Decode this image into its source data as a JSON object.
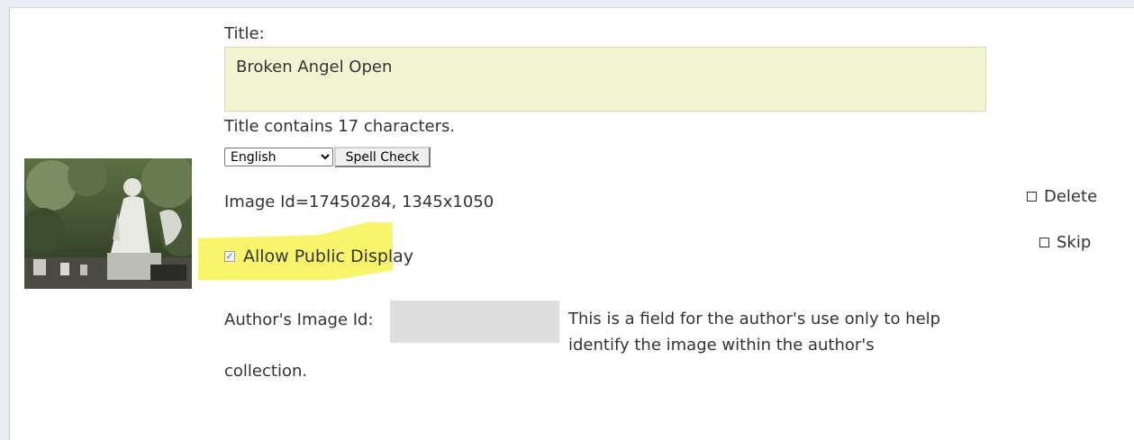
{
  "form": {
    "title_label": "Title:",
    "title_value": "Broken Angel Open",
    "title_count": "Title contains 17 characters.",
    "language": {
      "selected": "English"
    },
    "spell_check_label": "Spell Check",
    "image_id_text": "Image Id=17450284, 1345x1050",
    "allow_public": {
      "label": "Allow Public Display",
      "checked": true
    },
    "author_image_id": {
      "label": "Author's Image Id:",
      "value": ""
    },
    "author_help_text": "This is a field for the author's use only to help identify the image within the author's",
    "author_help_text_cont": "collection."
  },
  "options": {
    "delete_label": "Delete",
    "skip_label": "Skip"
  },
  "thumbnail": {
    "icon": "image-thumbnail"
  },
  "colors": {
    "title_bg": "#f3f4d1",
    "highlight": "#f8f56a",
    "author_input_bg": "#dddddd"
  }
}
